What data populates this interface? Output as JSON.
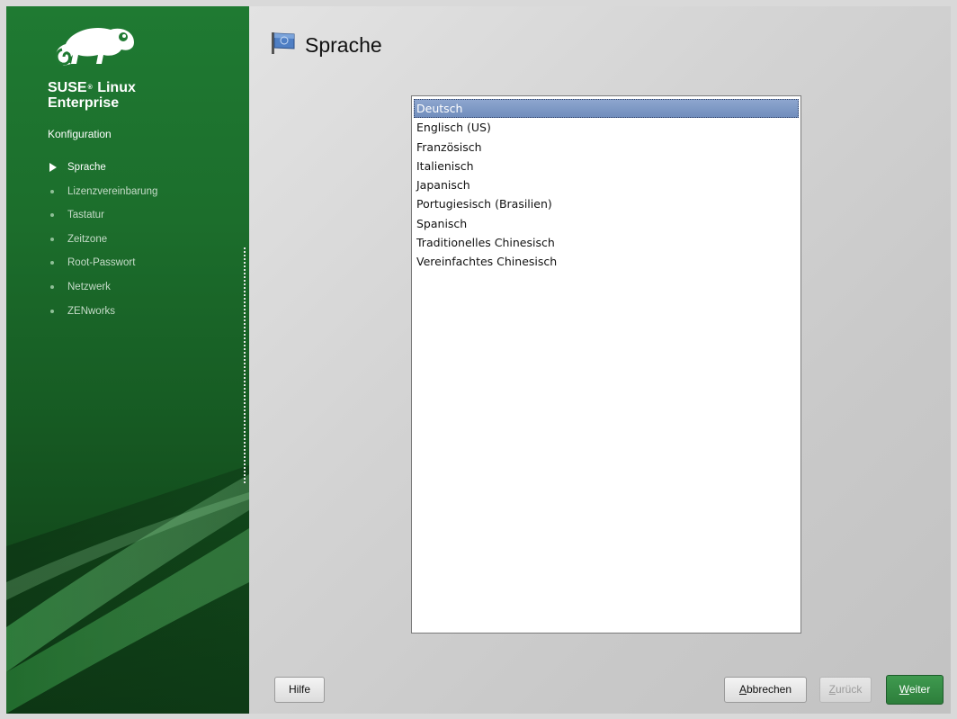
{
  "sidebar": {
    "brand_line1": "SUSE",
    "brand_reg": "®",
    "brand_line1b": "Linux",
    "brand_line2": "Enterprise",
    "section_title": "Konfiguration",
    "steps": [
      {
        "label": "Sprache",
        "active": true
      },
      {
        "label": "Lizenzvereinbarung",
        "active": false
      },
      {
        "label": "Tastatur",
        "active": false
      },
      {
        "label": "Zeitzone",
        "active": false
      },
      {
        "label": "Root-Passwort",
        "active": false
      },
      {
        "label": "Netzwerk",
        "active": false
      },
      {
        "label": "ZENworks",
        "active": false
      }
    ]
  },
  "main": {
    "title": "Sprache",
    "icon": "flag-icon",
    "languages": [
      "Deutsch",
      "Englisch (US)",
      "Französisch",
      "Italienisch",
      "Japanisch",
      "Portugiesisch (Brasilien)",
      "Spanisch",
      "Traditionelles Chinesisch",
      "Vereinfachtes Chinesisch"
    ],
    "selected_language": "Deutsch"
  },
  "buttons": {
    "help": "Hilfe",
    "abort_mnemonic": "A",
    "abort_rest": "bbrechen",
    "back_mnemonic": "Z",
    "back_rest": "urück",
    "next_mnemonic": "W",
    "next_rest": "eiter"
  },
  "colors": {
    "sidebar_green": "#1f7a32",
    "selection_blue": "#7a93c2",
    "next_button_green": "#2d7e3b"
  }
}
